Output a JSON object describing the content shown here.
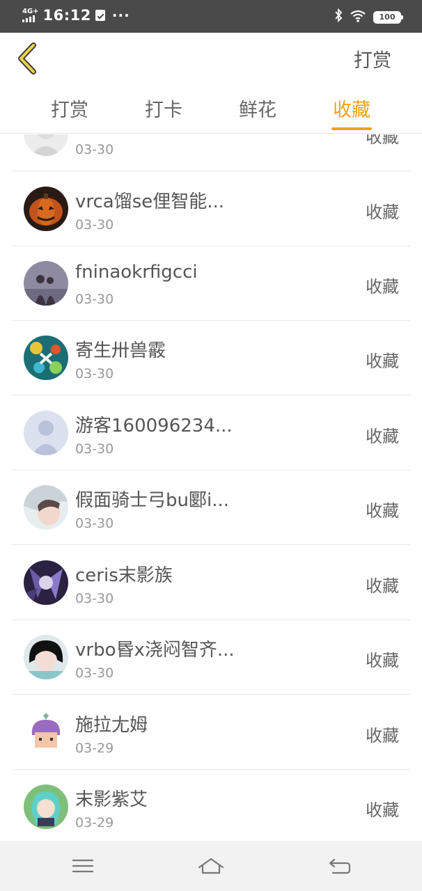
{
  "status_bar": {
    "network": "4G+",
    "time": "16:12",
    "dots": "···",
    "battery": "100",
    "bluetooth_icon": "bluetooth-icon",
    "wifi_icon": "wifi-icon"
  },
  "header": {
    "back_icon": "chevron-left-icon",
    "action_label": "打赏"
  },
  "tabs": [
    {
      "label": "打赏",
      "active": false
    },
    {
      "label": "打卡",
      "active": false
    },
    {
      "label": "鲜花",
      "active": false
    },
    {
      "label": "收藏",
      "active": true
    }
  ],
  "colors": {
    "accent": "#f4a117",
    "status_bar": "#4a4a4a"
  },
  "list": {
    "items": [
      {
        "name": "",
        "date": "03-30",
        "action": "收藏"
      },
      {
        "name": "vrca馏se俚智能...",
        "date": "03-30",
        "action": "收藏"
      },
      {
        "name": "fninaokrfigcci",
        "date": "03-30",
        "action": "收藏"
      },
      {
        "name": "寄生卅兽霰",
        "date": "03-30",
        "action": "收藏"
      },
      {
        "name": "游客160096234...",
        "date": "03-30",
        "action": "收藏"
      },
      {
        "name": "假面骑士弓bu郾i...",
        "date": "03-30",
        "action": "收藏"
      },
      {
        "name": "ceris末影族",
        "date": "03-30",
        "action": "收藏"
      },
      {
        "name": "vrbo昬x浇闷智齐...",
        "date": "03-30",
        "action": "收藏"
      },
      {
        "name": "施拉尢姆",
        "date": "03-29",
        "action": "收藏"
      },
      {
        "name": "末影紫艾",
        "date": "03-29",
        "action": "收藏"
      }
    ]
  },
  "nav_bar": {
    "menu_icon": "menu-icon",
    "home_icon": "home-icon",
    "back_icon": "back-arrow-icon"
  }
}
